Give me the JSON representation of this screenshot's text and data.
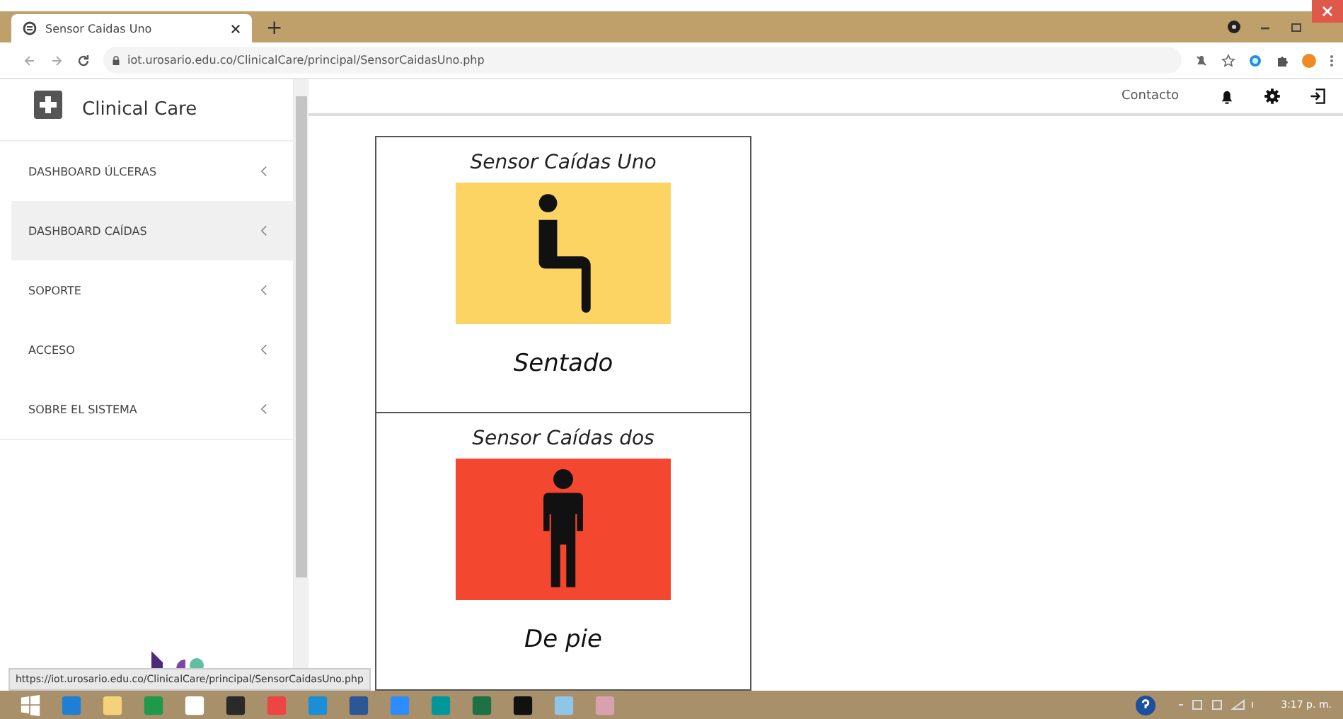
{
  "browser": {
    "tab": {
      "title": "Sensor Caidas Uno"
    },
    "new_tab": "+",
    "url": "iot.urosario.edu.co/ClinicalCare/principal/SensorCaidasUno.php",
    "status_url": "https://iot.urosario.edu.co/ClinicalCare/principal/SensorCaidasUno.php"
  },
  "app": {
    "title": "Clinical Care",
    "header_link": "Contacto"
  },
  "sidebar": {
    "items": [
      {
        "label": "DASHBOARD ÚLCERAS",
        "selected": false
      },
      {
        "label": "DASHBOARD CAÍDAS",
        "selected": true
      },
      {
        "label": "SOPORTE",
        "selected": false
      },
      {
        "label": "ACCESO",
        "selected": false
      },
      {
        "label": "SOBRE EL SISTEMA",
        "selected": false
      }
    ]
  },
  "sensors": [
    {
      "title": "Sensor Caídas Uno",
      "state": "Sentado",
      "kind": "sitting",
      "color": "#fbd463"
    },
    {
      "title": "Sensor Caídas dos",
      "state": "De pie",
      "kind": "standing",
      "color": "#f4472f"
    }
  ],
  "taskbar": {
    "time": "3:17 p. m."
  }
}
